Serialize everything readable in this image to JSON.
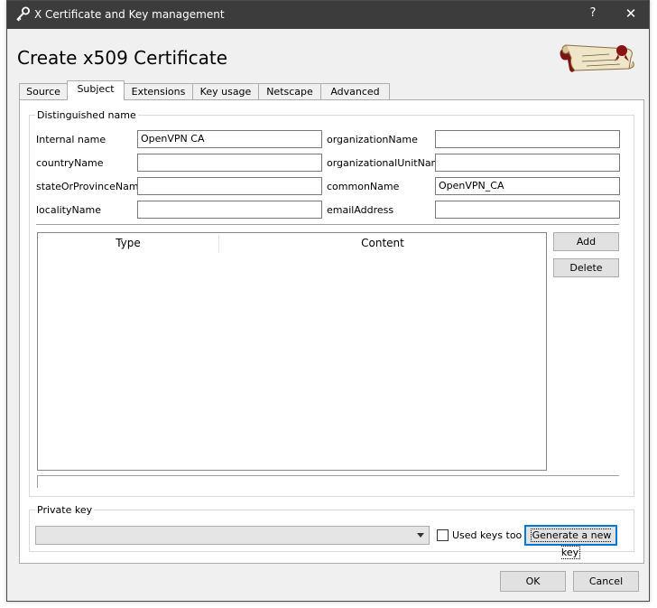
{
  "window": {
    "title": "X Certificate and Key management",
    "help_label": "?",
    "close_label": "✕"
  },
  "heading": "Create x509 Certificate",
  "tabs": [
    {
      "label": "Source"
    },
    {
      "label": "Subject"
    },
    {
      "label": "Extensions"
    },
    {
      "label": "Key usage"
    },
    {
      "label": "Netscape"
    },
    {
      "label": "Advanced"
    }
  ],
  "distinguished_name": {
    "title": "Distinguished name",
    "fields": {
      "internal_name": {
        "label": "Internal name",
        "value": "OpenVPN CA"
      },
      "country_name": {
        "label": "countryName",
        "value": ""
      },
      "state_or_province_name": {
        "label": "stateOrProvinceName",
        "value": ""
      },
      "locality_name": {
        "label": "localityName",
        "value": ""
      },
      "organization_name": {
        "label": "organizationName",
        "value": ""
      },
      "organizational_unit_name": {
        "label": "organizationalUnitName",
        "value": ""
      },
      "common_name": {
        "label": "commonName",
        "value": "OpenVPN_CA"
      },
      "email_address": {
        "label": "emailAddress",
        "value": ""
      }
    }
  },
  "table": {
    "columns": [
      "Type",
      "Content"
    ],
    "add_label": "Add",
    "delete_label": "Delete"
  },
  "private_key": {
    "title": "Private key",
    "selected": "",
    "used_keys_too_label": "Used keys too",
    "used_keys_too_checked": false,
    "generate_label": "Generate a new key"
  },
  "buttons": {
    "ok": "OK",
    "cancel": "Cancel"
  }
}
